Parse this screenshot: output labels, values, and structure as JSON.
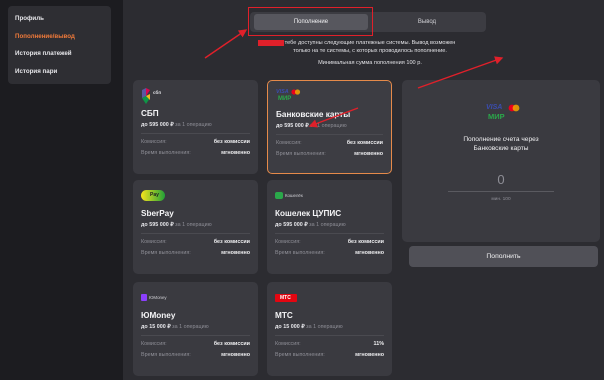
{
  "sidebar": {
    "items": [
      {
        "label": "Профиль"
      },
      {
        "label": "Пополнение/вывод"
      },
      {
        "label": "История платежей"
      },
      {
        "label": "История пари"
      }
    ]
  },
  "tabs": {
    "deposit": "Пополнение",
    "withdraw": "Вывод"
  },
  "info": {
    "line1": "тебе доступны следующие платежные системы. Вывод возможен",
    "line2": "только на те системы, с которых проводилось пополнение.",
    "min": "Минимальная сумма пополнения 100 р."
  },
  "labels": {
    "commission": "Комиссия:",
    "exec_time": "Время выполнения:",
    "per_operation": "за 1 операцию"
  },
  "cards": [
    {
      "title": "СБП",
      "logo_text": "сбп",
      "limit": "до 595 000 ₽",
      "commission": "без комиссии",
      "time": "мгновенно"
    },
    {
      "title": "Банковские карты",
      "logo_visa": "VISA",
      "logo_mir": "МИР",
      "limit": "до 595 000 ₽",
      "commission": "без комиссии",
      "time": "мгновенно"
    },
    {
      "title": "SberPay",
      "logo_text": "Pay",
      "limit": "до 595 000 ₽",
      "commission": "без комиссии",
      "time": "мгновенно"
    },
    {
      "title": "Кошелек ЦУПИС",
      "logo_text": "Кошелёк",
      "limit": "до 595 000 ₽",
      "commission": "без комиссии",
      "time": "мгновенно"
    },
    {
      "title": "ЮMoney",
      "logo_text": "ЮMoney",
      "limit": "до 15 000 ₽",
      "commission": "без комиссии",
      "time": "мгновенно"
    },
    {
      "title": "МТС",
      "logo_text": "МТС",
      "limit": "до 15 000 ₽",
      "commission": "11%",
      "time": "мгновенно"
    }
  ],
  "panel": {
    "logo_visa": "VISA",
    "logo_mir": "МИР",
    "title_line1": "Пополнение счета через",
    "title_line2": "Банковские карты",
    "amount": "0",
    "min": "мин. 100",
    "submit": "Пополнить"
  },
  "colors": {
    "accent": "#f07a3a",
    "annotation_red": "#e0202a"
  }
}
